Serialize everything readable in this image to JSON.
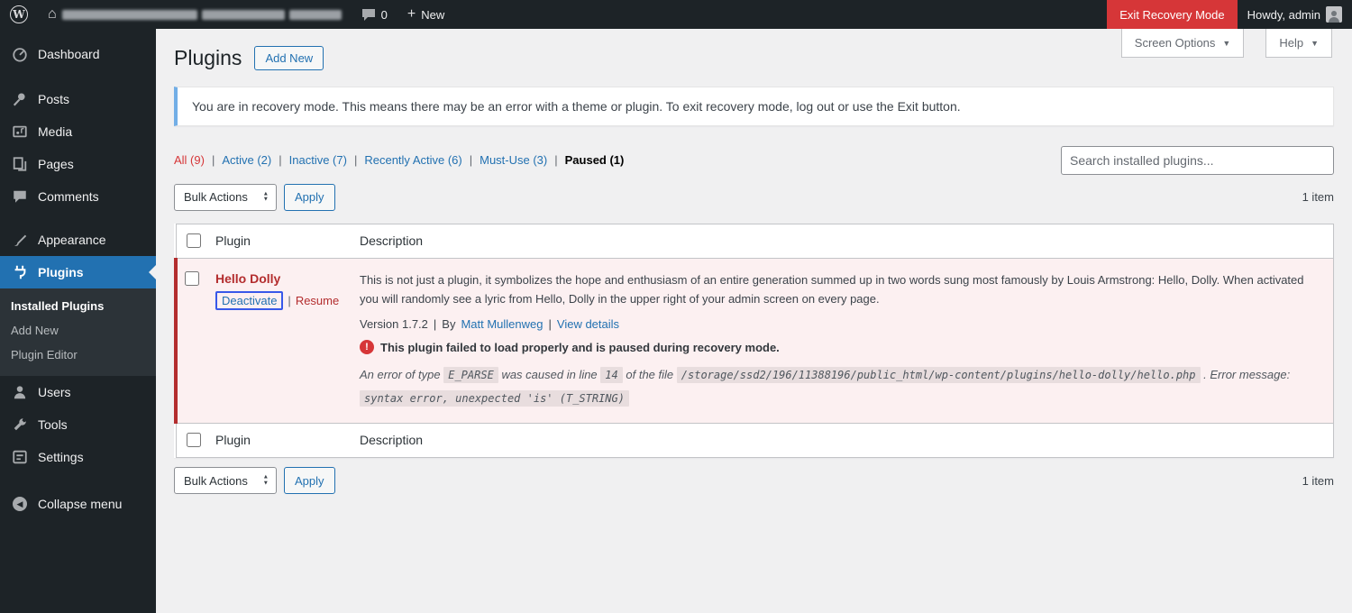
{
  "colors": {
    "accent_blue": "#2271b1",
    "danger_red": "#d63638",
    "paused_red": "#b32d2e",
    "notice_blue": "#72aee6",
    "admin_dark": "#1d2327"
  },
  "icons": {
    "wp_logo_glyph": "W",
    "home_glyph": "⌂",
    "plus_glyph": "+",
    "caret_down_glyph": "▼",
    "select_up_glyph": "▲",
    "select_down_glyph": "▼",
    "warning_glyph": "!",
    "collapse_glyph": "◀"
  },
  "admin_bar": {
    "comments_count": "0",
    "new_label": "New",
    "exit_recovery_label": "Exit Recovery Mode",
    "howdy": "Howdy, admin"
  },
  "sidebar": {
    "items": [
      "Dashboard",
      "Posts",
      "Media",
      "Pages",
      "Comments",
      "Appearance",
      "Plugins",
      "Users",
      "Tools",
      "Settings"
    ],
    "submenu": [
      "Installed Plugins",
      "Add New",
      "Plugin Editor"
    ],
    "collapse_label": "Collapse menu"
  },
  "page": {
    "title": "Plugins",
    "add_new": "Add New",
    "screen_options": "Screen Options",
    "help": "Help"
  },
  "notice": "You are in recovery mode. This means there may be an error with a theme or plugin. To exit recovery mode, log out or use the Exit button.",
  "filters": {
    "separator": "|",
    "items": [
      "All (9)",
      "Active (2)",
      "Inactive (7)",
      "Recently Active (6)",
      "Must-Use (3)",
      "Paused (1)"
    ]
  },
  "search_placeholder": "Search installed plugins...",
  "bulk": {
    "action_label": "Bulk Actions",
    "apply": "Apply",
    "count": "1 item"
  },
  "table": {
    "col_plugin": "Plugin",
    "col_description": "Description",
    "plugin": {
      "name": "Hello Dolly",
      "deactivate": "Deactivate",
      "action_separator": "|",
      "resume": "Resume",
      "description": "This is not just a plugin, it symbolizes the hope and enthusiasm of an entire generation summed up in two words sung most famously by Louis Armstrong: Hello, Dolly. When activated you will randomly see a lyric from Hello, Dolly in the upper right of your admin screen on every page.",
      "version": "Version 1.7.2",
      "meta_separator": "|",
      "by": "By",
      "author": "Matt Mullenweg",
      "view_details": "View details",
      "paused_message": "This plugin failed to load properly and is paused during recovery mode.",
      "error_prefix": "An error of type",
      "error_type": "E_PARSE",
      "error_mid1": "was caused in line",
      "error_line": "14",
      "error_mid2": "of the file",
      "error_file": "/storage/ssd2/196/11388196/public_html/wp-content/plugins/hello-dolly/hello.php",
      "error_mid3": ". Error message:",
      "error_message": "syntax error, unexpected 'is' (T_STRING)"
    }
  }
}
